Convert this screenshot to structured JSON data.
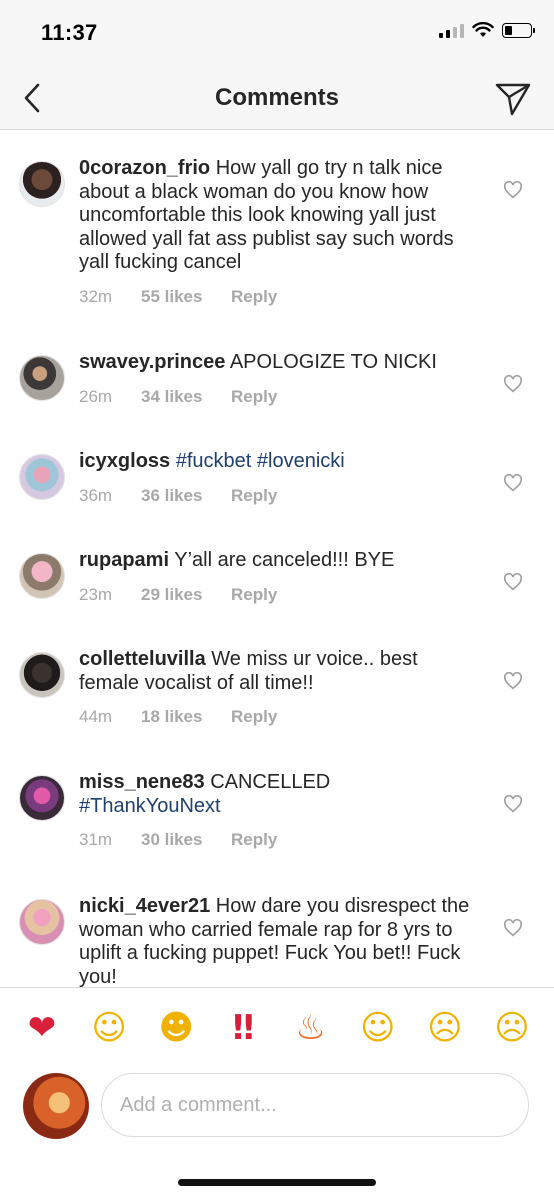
{
  "status": {
    "time": "11:37"
  },
  "nav": {
    "title": "Comments"
  },
  "comments": [
    {
      "username": "0corazon_frio",
      "text": "How yall go try n talk nice about a black woman do you know how uncomfortable this look knowing yall just allowed yall fat ass publist say such words yall fucking cancel",
      "hashtags": "",
      "time": "32m",
      "likes": "55 likes",
      "reply": "Reply"
    },
    {
      "username": "swavey.princee",
      "text": "APOLOGIZE TO NICKI",
      "hashtags": "",
      "time": "26m",
      "likes": "34 likes",
      "reply": "Reply"
    },
    {
      "username": "icyxgloss",
      "text": "",
      "hashtags": "#fuckbet #lovenicki",
      "time": "36m",
      "likes": "36 likes",
      "reply": "Reply"
    },
    {
      "username": "rupapami",
      "text": "Y’all are canceled!!! BYE",
      "hashtags": "",
      "time": "23m",
      "likes": "29 likes",
      "reply": "Reply"
    },
    {
      "username": "colletteluvilla",
      "text": "We miss ur voice.. best female vocalist of all time!!",
      "hashtags": "",
      "time": "44m",
      "likes": "18 likes",
      "reply": "Reply"
    },
    {
      "username": "miss_nene83",
      "text": "CANCELLED",
      "hashtags": "#ThankYouNext",
      "time": "31m",
      "likes": "30 likes",
      "reply": "Reply"
    },
    {
      "username": "nicki_4ever21",
      "text": "How dare you disrespect the woman who carried female rap for 8 yrs to uplift a fucking puppet! Fuck You bet!! Fuck you!",
      "hashtags": "",
      "time": "",
      "likes": "",
      "reply": ""
    }
  ],
  "emoji_bar": [
    "heart",
    "kissing-face",
    "tears-of-joy",
    "double-exclamation",
    "fire",
    "heart-eyes",
    "crying-face",
    "weary-face"
  ],
  "composer": {
    "placeholder": "Add a comment..."
  },
  "colors": {
    "hashtag": "#1f3f6e",
    "meta": "#a8a8a8",
    "text": "#262626"
  }
}
